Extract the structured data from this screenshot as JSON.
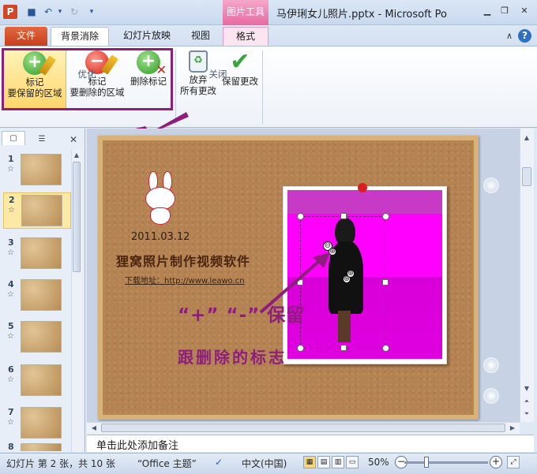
{
  "window": {
    "title": "马伊琍女儿照片.pptx - Microsoft Po",
    "app_icon": "P",
    "context_tab_group": "图片工具"
  },
  "quick_access": [
    {
      "name": "save-icon",
      "glyph": "💾"
    },
    {
      "name": "undo-icon",
      "glyph": "↶"
    },
    {
      "name": "undo-dropdown-icon",
      "glyph": "▾"
    },
    {
      "name": "redo-icon",
      "glyph": "↻"
    },
    {
      "name": "customize-qat-icon",
      "glyph": "▾"
    }
  ],
  "window_controls": {
    "minimize": "▭",
    "restore": "▭",
    "close": "✕",
    "ribbon_min": "∧",
    "help": "?"
  },
  "tabs": {
    "file": "文件",
    "remove_background": "背景消除",
    "slide_show": "幻灯片放映",
    "view": "视图",
    "format": "格式"
  },
  "ribbon": {
    "mark_keep": {
      "line1": "标记",
      "line2": "要保留的区域"
    },
    "mark_remove": {
      "line1": "标记",
      "line2": "要删除的区域"
    },
    "delete_mark": {
      "line1": "删除标记"
    },
    "discard_changes": {
      "line1": "放弃",
      "line2": "所有更改"
    },
    "keep_changes": {
      "line1": "保留更改"
    },
    "group_optimize": "优化",
    "group_close": "关闭"
  },
  "left_pane": {
    "slides": [
      {
        "num": "1",
        "star": "☆"
      },
      {
        "num": "2",
        "star": "☆",
        "selected": true
      },
      {
        "num": "3",
        "star": "☆"
      },
      {
        "num": "4",
        "star": "☆"
      },
      {
        "num": "5",
        "star": "☆"
      },
      {
        "num": "6",
        "star": "☆"
      },
      {
        "num": "7",
        "star": "☆"
      },
      {
        "num": "8",
        "star": ""
      }
    ]
  },
  "slide": {
    "date": "2011.03.12",
    "heading": "狸窝照片制作视频软件",
    "link_label": "下载地址：",
    "link_url": "http://www.leawo.cn",
    "overlay_line1": "“+” “-” 保留",
    "overlay_line2": "跟删除的标志",
    "minus_marker": "⊖",
    "plus_marker": "⊕"
  },
  "notes": {
    "placeholder": "单击此处添加备注"
  },
  "statusbar": {
    "slide_info": "幻灯片 第 2 张，共 10 张",
    "theme": "“Office 主题”",
    "language": "中文(中国)",
    "zoom": "50%",
    "zoom_level_percent": 50
  }
}
